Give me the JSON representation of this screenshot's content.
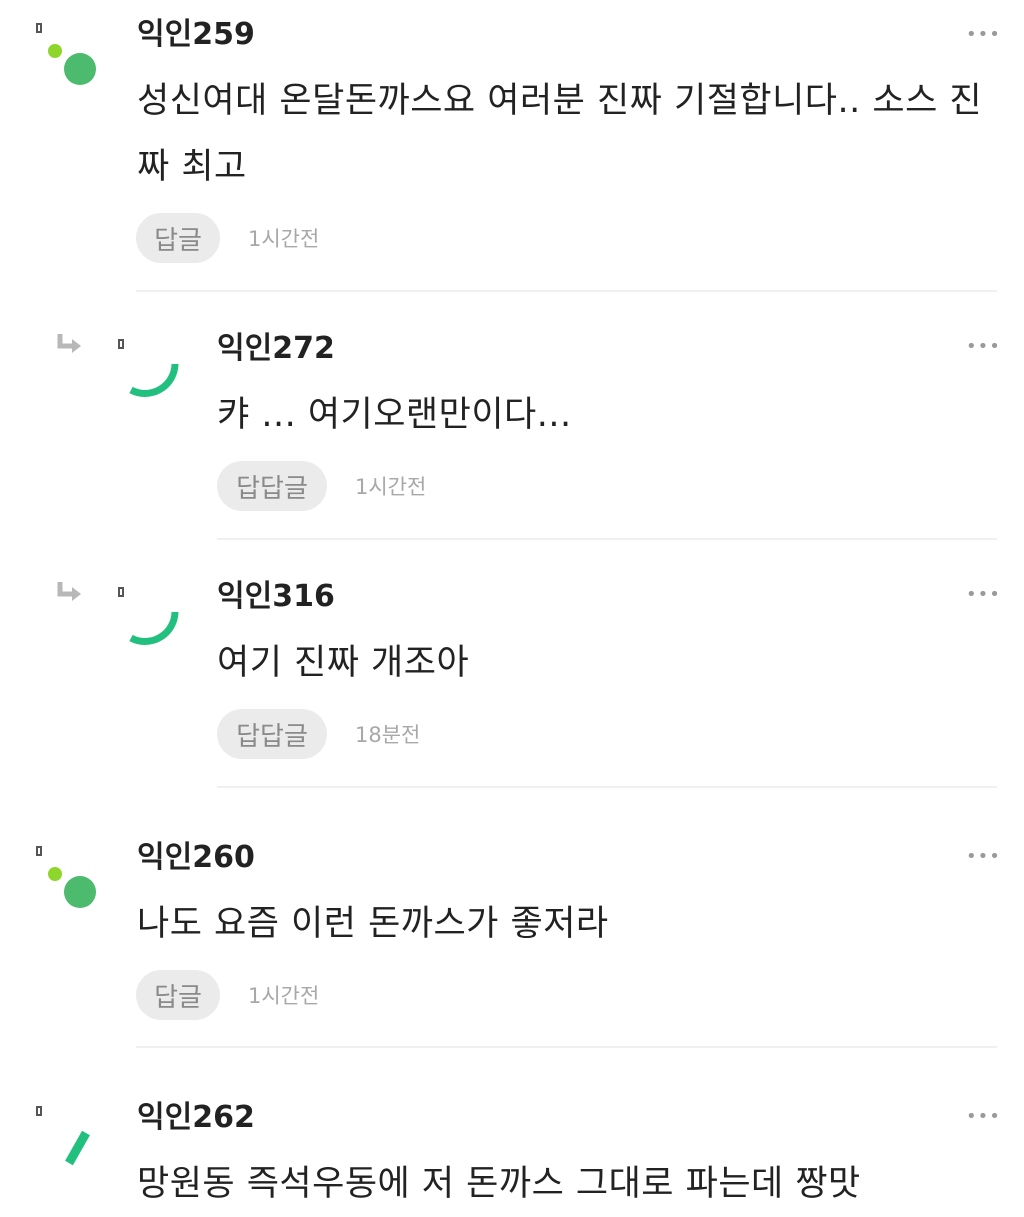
{
  "comments": [
    {
      "author": "익인259",
      "text": "성신여대 온달돈까스요 여러분 진짜 기절합니다.. 소스 진짜 최고",
      "reply_label": "답글",
      "time": "1시간전",
      "avatar_icon": "dots-avatar-icon"
    },
    {
      "author": "익인272",
      "text": "캬 ... 여기오랜만이다...",
      "reply_label": "답답글",
      "time": "1시간전",
      "avatar_icon": "arc-avatar-icon",
      "is_reply": true
    },
    {
      "author": "익인316",
      "text": "여기 진짜 개조아",
      "reply_label": "답답글",
      "time": "18분전",
      "avatar_icon": "arc-avatar-icon",
      "is_reply": true
    },
    {
      "author": "익인260",
      "text": "나도 요즘 이런 돈까스가 좋저라",
      "reply_label": "답글",
      "time": "1시간전",
      "avatar_icon": "dots-avatar-icon"
    },
    {
      "author": "익인262",
      "text": "망원동 즉석우동에 저 돈까스 그대로 파는데 짱맛",
      "avatar_icon": "slash-avatar-icon"
    }
  ],
  "more_icon": "more-dots-icon",
  "colors": {
    "accent_green": "#21c07f",
    "dot_green": "#4cbb6e",
    "dot_lime": "#8ed62b",
    "button_bg": "#ebebeb"
  }
}
